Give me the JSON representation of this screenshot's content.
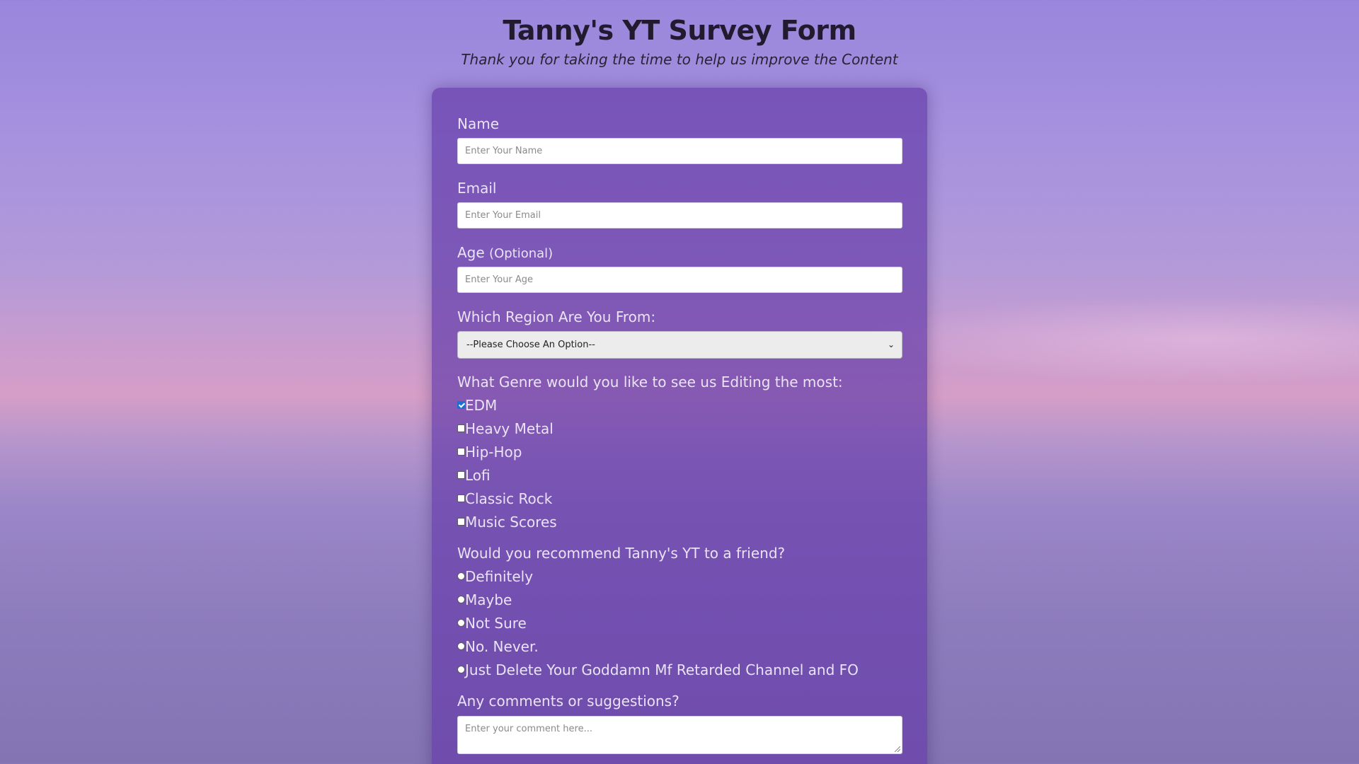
{
  "header": {
    "title": "Tanny's YT Survey Form",
    "subtitle": "Thank you for taking the time to help us improve the Content"
  },
  "form": {
    "name": {
      "label": "Name",
      "placeholder": "Enter Your Name"
    },
    "email": {
      "label": "Email",
      "placeholder": "Enter Your Email"
    },
    "age": {
      "label": "Age",
      "label_note": "(Optional)",
      "placeholder": "Enter Your Age"
    },
    "region": {
      "label": "Which Region Are You From:",
      "selected": "--Please Choose An Option--"
    },
    "genre": {
      "label": "What Genre would you like to see us Editing the most:",
      "options": [
        {
          "label": "EDM",
          "checked": true
        },
        {
          "label": "Heavy Metal",
          "checked": false
        },
        {
          "label": "Hip-Hop",
          "checked": false
        },
        {
          "label": "Lofi",
          "checked": false
        },
        {
          "label": "Classic Rock",
          "checked": false
        },
        {
          "label": "Music Scores",
          "checked": false
        }
      ]
    },
    "recommend": {
      "label": "Would you recommend Tanny's YT to a friend?",
      "options": [
        {
          "label": "Definitely",
          "selected": false
        },
        {
          "label": "Maybe",
          "selected": false
        },
        {
          "label": "Not Sure",
          "selected": false
        },
        {
          "label": "No. Never.",
          "selected": false
        },
        {
          "label": "Just Delete Your Goddamn Mf Retarded Channel and FO",
          "selected": false
        }
      ]
    },
    "comments": {
      "label": "Any comments or suggestions?",
      "placeholder": "Enter your comment here..."
    }
  }
}
